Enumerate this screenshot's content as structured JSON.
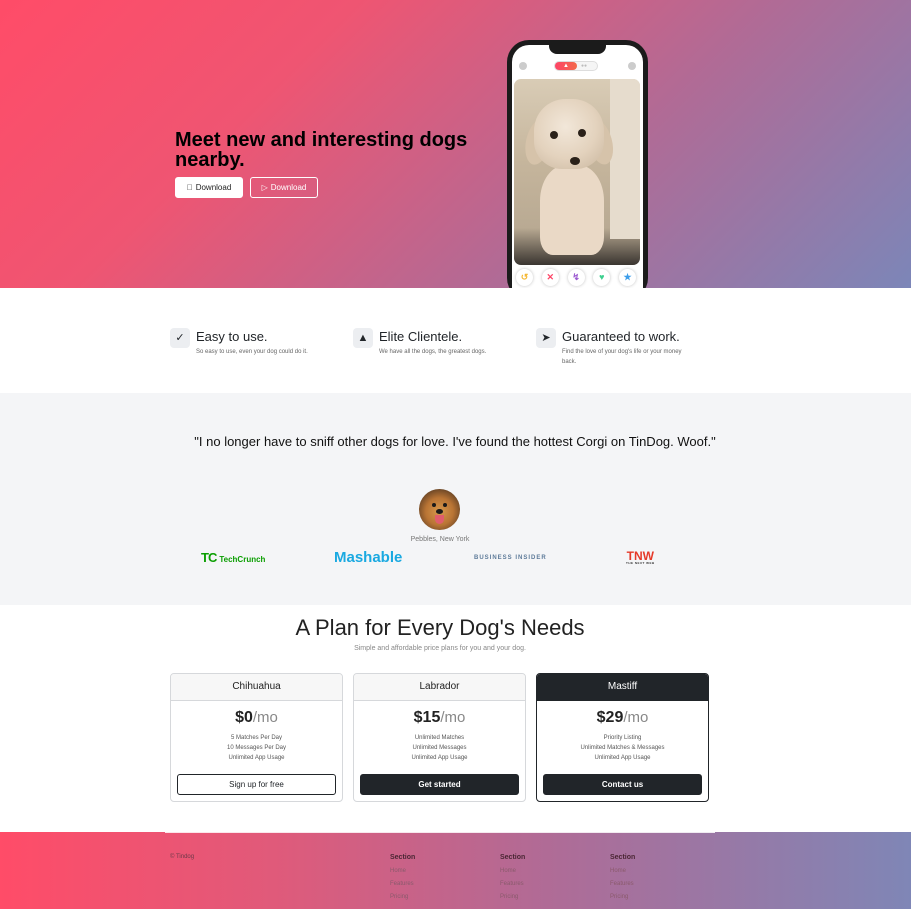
{
  "hero": {
    "title": "Meet new and interesting dogs nearby.",
    "download_apple": "Download",
    "download_play": "Download",
    "apple_icon": "apple-icon",
    "play_icon": "google-play-icon"
  },
  "features": [
    {
      "icon": "check-circle-icon",
      "title": "Easy to use.",
      "text": "So easy to use, even your dog could do it."
    },
    {
      "icon": "graduation-cap-icon",
      "title": "Elite Clientele.",
      "text": "We have all the dogs, the greatest dogs."
    },
    {
      "icon": "heart-arrow-icon",
      "title": "Guaranteed to work.",
      "text": "Find the love of your dog's life or your money back."
    }
  ],
  "testimonial": {
    "quote": "\"I no longer have to sniff other dogs for love. I've found the hottest Corgi on TinDog. Woof.\"",
    "caption": "Pebbles, New York",
    "logos": {
      "techcrunch": "TechCrunch",
      "mashable": "Mashable",
      "business_insider": "BUSINESS INSIDER",
      "tnw": "TNW"
    }
  },
  "pricing": {
    "title": "A Plan for Every Dog's Needs",
    "subtitle": "Simple and affordable price plans for you and your dog.",
    "plans": [
      {
        "name": "Chihuahua",
        "price": "$0",
        "per": "/mo",
        "features": [
          "5 Matches Per Day",
          "10 Messages Per Day",
          "Unlimited App Usage"
        ],
        "cta": "Sign up for free"
      },
      {
        "name": "Labrador",
        "price": "$15",
        "per": "/mo",
        "features": [
          "Unlimited Matches",
          "Unlimited Messages",
          "Unlimited App Usage"
        ],
        "cta": "Get started"
      },
      {
        "name": "Mastiff",
        "price": "$29",
        "per": "/mo",
        "features": [
          "Priority Listing",
          "Unlimited Matches & Messages",
          "Unlimited App Usage"
        ],
        "cta": "Contact us"
      }
    ]
  },
  "footer": {
    "copyright": "© Tindog",
    "columns": [
      {
        "title": "Section",
        "links": [
          "Home",
          "Features",
          "Pricing"
        ]
      },
      {
        "title": "Section",
        "links": [
          "Home",
          "Features",
          "Pricing"
        ]
      },
      {
        "title": "Section",
        "links": [
          "Home",
          "Features",
          "Pricing"
        ]
      }
    ]
  },
  "colors": {
    "gradient_start": "#ff4c68",
    "gradient_end": "#7c86b8",
    "dark": "#212529"
  }
}
